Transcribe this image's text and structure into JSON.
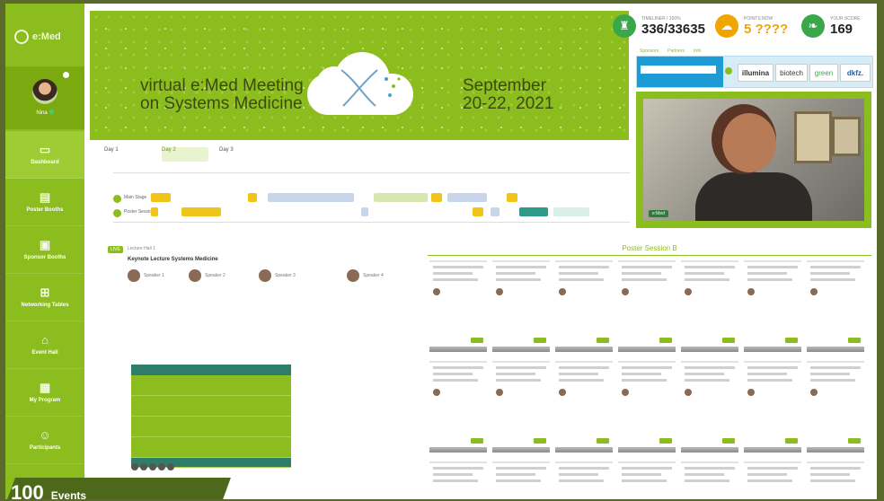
{
  "sidebar": {
    "logo": "e:Med",
    "user_name": "Nina",
    "items": [
      {
        "label": "Dashboard",
        "icon": "monitor-icon"
      },
      {
        "label": "Poster Booths",
        "icon": "poster-icon"
      },
      {
        "label": "Sponsor Booths",
        "icon": "gift-icon"
      },
      {
        "label": "Networking Tables",
        "icon": "table-icon"
      },
      {
        "label": "Event Hall",
        "icon": "hall-icon"
      },
      {
        "label": "My Program",
        "icon": "calendar-icon"
      },
      {
        "label": "Participants",
        "icon": "people-icon"
      }
    ]
  },
  "banner": {
    "left_line1": "virtual e:Med Meeting",
    "left_line2": "on Systems Medicine",
    "right_line1": "September",
    "right_line2": "20-22, 2021"
  },
  "stats": [
    {
      "label": "TIMELINER / 100%",
      "value": "336/33635",
      "icon": "trophy-icon",
      "color": "#3aa84a"
    },
    {
      "label": "POINTS NOW",
      "value": "5 ????",
      "icon": "cloud-icon",
      "color": "#f0a500"
    },
    {
      "label": "YOUR SCORE",
      "value": "169",
      "icon": "leaf-icon",
      "color": "#3aa84a"
    }
  ],
  "sponsors": {
    "tabs": [
      "Sponsors",
      "Partners",
      "Info"
    ],
    "logos": [
      "illumina",
      "biotech",
      "green",
      "dkfz."
    ]
  },
  "video": {
    "badge": "e:Med"
  },
  "timeline": {
    "days": [
      "Day 1",
      "Day 2",
      "Day 3"
    ],
    "rows": [
      "Main Stage",
      "Poster Session"
    ]
  },
  "agenda": {
    "live": "LIVE",
    "header": "Lecture Hall 1",
    "title": "Keynote Lecture Systems Medicine",
    "speakers": [
      "Speaker 1",
      "Speaker 2",
      "Speaker 3",
      "Speaker 4"
    ]
  },
  "posters": {
    "title": "Poster Session B"
  },
  "overlay": {
    "number": "100",
    "label": "Events"
  },
  "colors": {
    "accent": "#8cbd1e",
    "teal": "#2e7d6a",
    "orange": "#f0a500"
  }
}
